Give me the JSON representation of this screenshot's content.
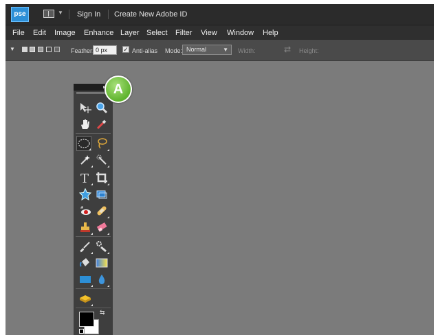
{
  "titlebar": {
    "logo_text": "pse",
    "sign_in": "Sign In",
    "create_id": "Create New Adobe ID"
  },
  "menubar": {
    "items": [
      "File",
      "Edit",
      "Image",
      "Enhance",
      "Layer",
      "Select",
      "Filter",
      "View",
      "Window",
      "Help"
    ]
  },
  "options": {
    "feather_label": "Feather:",
    "feather_value": "0 px",
    "antialias_label": "Anti-alias",
    "antialias_checked": true,
    "mode_label": "Mode:",
    "mode_value": "Normal",
    "width_label": "Width:",
    "height_label": "Height:"
  },
  "toolbox": {
    "active_tool": "rectangular-marquee-tool",
    "foreground_color": "#000000",
    "background_color": "#ffffff"
  },
  "callout": {
    "label": "A"
  },
  "colors": {
    "app_bg": "#7b7b7b",
    "titlebar_bg": "#2b2b2b",
    "callout_green": "#5fb32e",
    "logo_blue": "#2d8fd6"
  }
}
